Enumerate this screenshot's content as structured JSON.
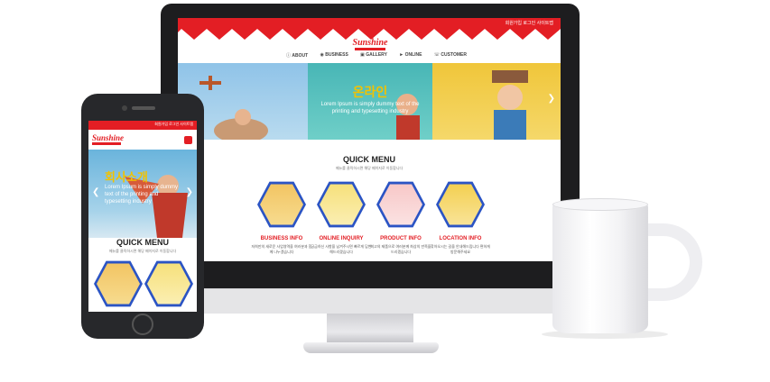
{
  "colors": {
    "brand_red": "#e31e24",
    "accent_yellow": "#f2c200",
    "hex_border": "#2b54c4"
  },
  "site": {
    "top_bar_text": "회원가입  로그인  사이트맵",
    "logo_text": "Sunshine",
    "nav": [
      {
        "icon": "info-icon",
        "label": "ABOUT"
      },
      {
        "icon": "briefcase-icon",
        "label": "BUSINESS"
      },
      {
        "icon": "gallery-icon",
        "label": "GALLERY"
      },
      {
        "icon": "online-icon",
        "label": "ONLINE"
      },
      {
        "icon": "headset-icon",
        "label": "CUSTOMER"
      }
    ],
    "hero_title": "온라인",
    "hero_subtitle": "Lorem Ipsum is simply dummy text of the printing and typesetting industry",
    "quick_menu_title": "QUICK MENU",
    "quick_menu_subtitle": "메뉴를 클릭하시면 해당 페이지로 이동합니다",
    "quick_menu": [
      {
        "title": "BUSINESS INFO",
        "text": "저희만의 새로운 사업영역을 여러분과 함께 나누겠습니다"
      },
      {
        "title": "ONLINE INQUIRY",
        "text": "궁금하신 사항을 남겨주시면 빠르게 답변해드리겠습니다"
      },
      {
        "title": "PRODUCT INFO",
        "text": "최고의 제품으로 여러분께 최상의 만족을 드리겠습니다"
      },
      {
        "title": "LOCATION INFO",
        "text": "찾아오시는 길을 안내해드립니다 편하게 방문해주세요"
      }
    ]
  },
  "mobile": {
    "top_bar_text": "회원가입  로그인  사이트맵",
    "logo_text": "Sunshine",
    "hero_title": "회사소개",
    "hero_subtitle": "Lorem Ipsum is simply dummy text of the printing and typesetting industry",
    "quick_menu_title": "QUICK MENU",
    "quick_menu_subtitle": "메뉴를 클릭하시면 해당 페이지로 이동합니다"
  }
}
